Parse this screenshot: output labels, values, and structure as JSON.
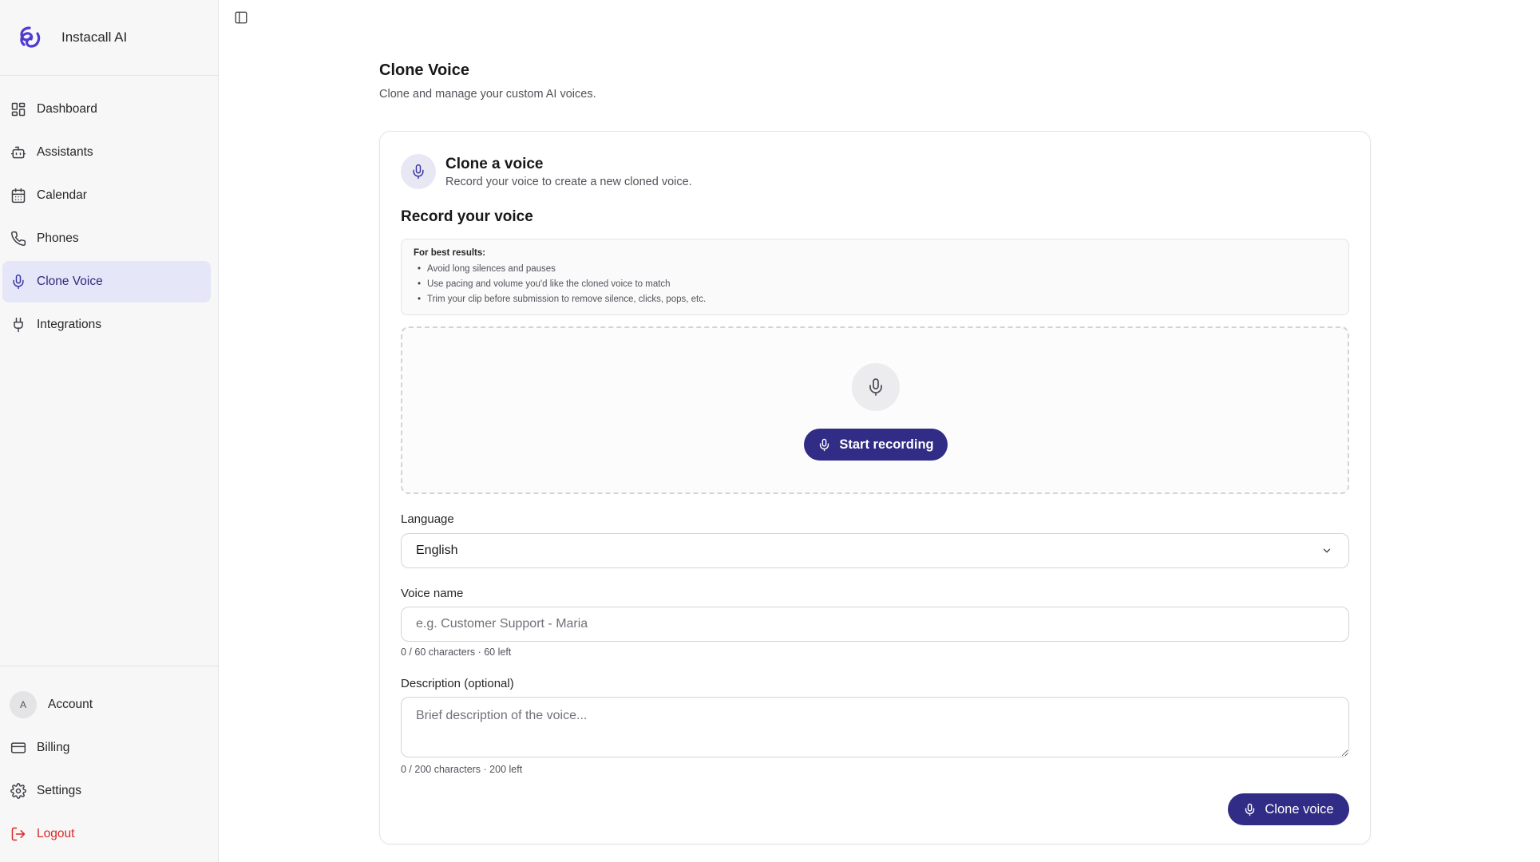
{
  "app": {
    "name": "Instacall AI"
  },
  "sidebar": {
    "items": [
      {
        "label": "Dashboard",
        "icon": "dashboard-icon"
      },
      {
        "label": "Assistants",
        "icon": "bot-icon"
      },
      {
        "label": "Calendar",
        "icon": "calendar-icon"
      },
      {
        "label": "Phones",
        "icon": "phone-icon"
      },
      {
        "label": "Clone Voice",
        "icon": "mic-icon",
        "active": true
      },
      {
        "label": "Integrations",
        "icon": "plug-icon"
      }
    ],
    "bottom": {
      "account_initial": "A",
      "account_label": "Account",
      "billing_label": "Billing",
      "settings_label": "Settings",
      "logout_label": "Logout"
    }
  },
  "page": {
    "title": "Clone Voice",
    "subtitle": "Clone and manage your custom AI voices."
  },
  "card": {
    "title": "Clone a voice",
    "subtitle": "Record your voice to create a new cloned voice.",
    "section_title": "Record your voice",
    "tips": {
      "title": "For best results:",
      "items": [
        "Avoid long silences and pauses",
        "Use pacing and volume you'd like the cloned voice to match",
        "Trim your clip before submission to remove silence, clicks, pops, etc."
      ]
    },
    "record_button": "Start recording",
    "language": {
      "label": "Language",
      "value": "English"
    },
    "voice_name": {
      "label": "Voice name",
      "placeholder": "e.g. Customer Support - Maria",
      "hint": "0 / 60 characters · 60 left"
    },
    "description": {
      "label": "Description (optional)",
      "placeholder": "Brief description of the voice...",
      "hint": "0 / 200 characters · 200 left"
    },
    "submit_button": "Clone voice"
  },
  "colors": {
    "primary": "#312c85",
    "active_bg": "#e5e6f8",
    "danger": "#dc2626",
    "brand": "#4f3bd1"
  }
}
